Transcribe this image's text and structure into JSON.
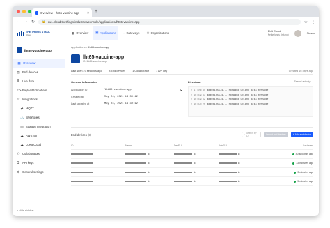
{
  "browser": {
    "tab_title": "Overview - lht65-vaccine-app",
    "url": "eu1.cloud.thethings.industries/console/applications/lht65-vaccine-app",
    "new_tab": "+"
  },
  "header": {
    "logo_line1": "THE THINGS STACK",
    "logo_line2": "Cloud",
    "nav": [
      {
        "label": "Overview",
        "icon": "overview-icon"
      },
      {
        "label": "Applications",
        "icon": "applications-icon"
      },
      {
        "label": "Gateways",
        "icon": "gateways-icon"
      },
      {
        "label": "Organizations",
        "icon": "organizations-icon"
      }
    ],
    "cluster": "EU1 Cloud",
    "cluster_sub": "Netherlands (Ireland)",
    "user": "Simon"
  },
  "sidebar": {
    "app_name": "lht65-vaccine-app",
    "items": [
      {
        "label": "Overview",
        "icon": "overview-icon",
        "sub": false
      },
      {
        "label": "End devices",
        "icon": "devices-icon",
        "sub": false
      },
      {
        "label": "Live data",
        "icon": "list-icon",
        "sub": false
      },
      {
        "label": "Payload formatters",
        "icon": "code-icon",
        "sub": false
      },
      {
        "label": "Integrations",
        "icon": "integrations-icon",
        "sub": false
      },
      {
        "label": "MQTT",
        "icon": "mqtt-icon",
        "sub": true
      },
      {
        "label": "Webhooks",
        "icon": "webhook-icon",
        "sub": true
      },
      {
        "label": "Storage Integration",
        "icon": "storage-icon",
        "sub": true
      },
      {
        "label": "AWS IoT",
        "icon": "aws-icon",
        "sub": true
      },
      {
        "label": "LoRa Cloud",
        "icon": "cloud-icon",
        "sub": true
      },
      {
        "label": "Collaborators",
        "icon": "people-icon",
        "sub": false
      },
      {
        "label": "API keys",
        "icon": "key-icon",
        "sub": false
      },
      {
        "label": "General settings",
        "icon": "settings-icon",
        "sub": false
      }
    ],
    "hide": "Hide sidebar"
  },
  "main": {
    "breadcrumb_root": "Applications",
    "breadcrumb_current": "lht65-vaccine-app",
    "title": "lht65-vaccine-app",
    "app_id": "ID: lht65-vaccine-app",
    "tabs": [
      "Last seen 27 seconds ago",
      "8 End devices",
      "1 Collaborator",
      "1 API key"
    ],
    "created": "Created 16 days ago",
    "general_heading": "General information",
    "general": [
      {
        "k": "Application ID",
        "v": "lht65-vaccine-app",
        "copy": true
      },
      {
        "k": "Created at",
        "v": "May 24, 2021 14:30:12",
        "copy": false
      },
      {
        "k": "Last updated at",
        "v": "May 24, 2021 14:30:12",
        "copy": false
      }
    ],
    "live_heading": "Live data",
    "live_see_all": "See all activity →",
    "events": [
      {
        "time": "17:06:4x",
        "dev": "a84041x5574...",
        "msg": "Forward uplink data message"
      },
      {
        "time": "16:59:33",
        "dev": "a84041x5574...",
        "msg": "Forward uplink data message"
      },
      {
        "time": "16:59:32",
        "dev": "a84041x5574...",
        "msg": "Forward uplink data message"
      },
      {
        "time": "16:54:25",
        "dev": "a84041x5574...",
        "msg": "Forward uplink data message"
      }
    ],
    "devices_title": "End devices (8)",
    "search_placeholder": "Search by ID",
    "import_label": "Import end devices",
    "add_label": "+ Add end device",
    "columns": [
      "ID",
      "Name",
      "DevEUI",
      "JoinEUI",
      "Last seen"
    ],
    "rows": [
      {
        "seen": "40 seconds ago"
      },
      {
        "seen": "33 minutes ago"
      },
      {
        "seen": "3 minutes ago"
      },
      {
        "seen": "5 minutes ago"
      }
    ]
  },
  "colors": {
    "accent": "#1b5cfd",
    "brand": "#0d47a1",
    "ok": "#16a34a"
  }
}
